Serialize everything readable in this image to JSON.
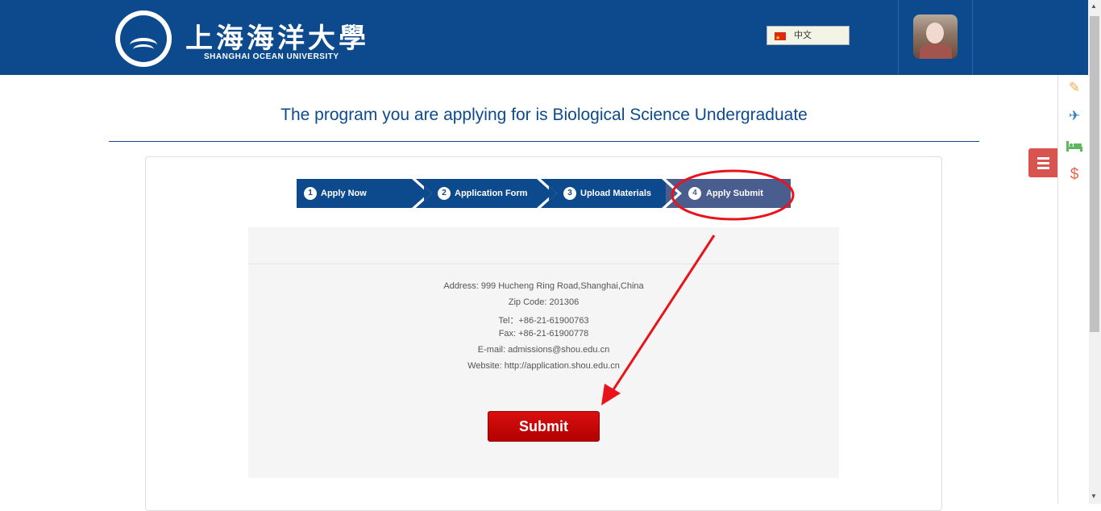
{
  "header": {
    "logo_cn": "上海海洋大學",
    "logo_en": "SHANGHAI OCEAN UNIVERSITY",
    "language": {
      "selected": "中文",
      "flag_icon": "china-flag-icon"
    },
    "colors": {
      "brand": "#0d4a8d"
    }
  },
  "side_rail": {
    "icons": [
      "edit-icon",
      "plane-icon",
      "bed-icon",
      "dollar-icon"
    ],
    "menu_icon": "hamburger-menu-icon"
  },
  "main": {
    "title": "The program you are applying for is Biological Science Undergraduate",
    "steps": [
      {
        "num": "1",
        "label": "Apply Now"
      },
      {
        "num": "2",
        "label": "Application Form"
      },
      {
        "num": "3",
        "label": "Upload Materials"
      },
      {
        "num": "4",
        "label": "Apply Submit",
        "active": true
      }
    ],
    "contact": {
      "address": "Address: 999 Hucheng Ring Road,Shanghai,China",
      "zip": "Zip Code: 201306",
      "tel": "Tel：+86-21-61900763",
      "fax": "Fax: +86-21-61900778",
      "email": "E-mail: admissions@shou.edu.cn",
      "website": "Website: http://application.shou.edu.cn"
    },
    "submit_label": "Submit",
    "colors": {
      "submit": "#c40000",
      "active_step": "#4a5d8f",
      "annotation": "#e8131b"
    }
  }
}
